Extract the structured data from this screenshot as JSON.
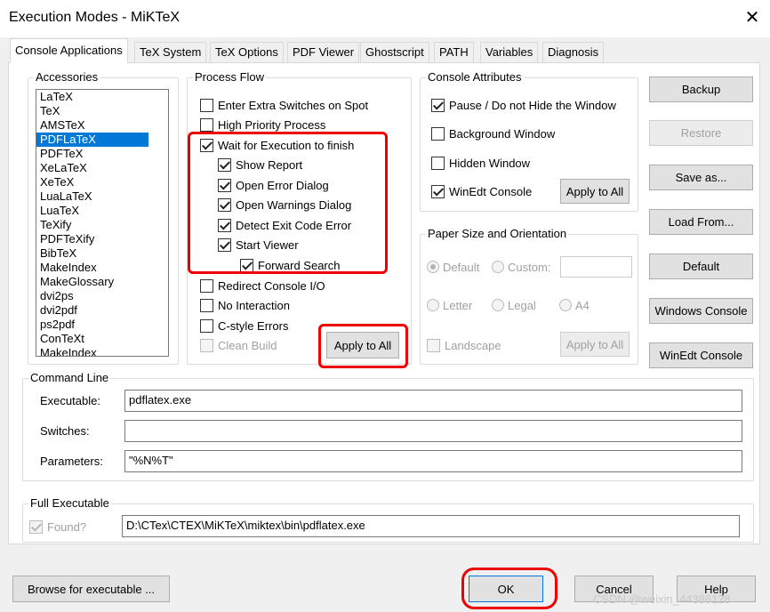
{
  "window": {
    "title": "Execution Modes - MiKTeX",
    "close": "✕"
  },
  "tabs": [
    "Console Applications",
    "TeX System",
    "TeX Options",
    "PDF Viewer",
    "Ghostscript",
    "PATH",
    "Variables",
    "Diagnosis"
  ],
  "accessories": {
    "title": "Accessories",
    "items": [
      "LaTeX",
      "TeX",
      "AMSTeX",
      "PDFLaTeX",
      "PDFTeX",
      "XeLaTeX",
      "XeTeX",
      "LuaLaTeX",
      "LuaTeX",
      "TeXify",
      "PDFTeXify",
      "BibTeX",
      "MakeIndex",
      "MakeGlossary",
      "dvi2ps",
      "dvi2pdf",
      "ps2pdf",
      "ConTeXt",
      "MakeIndex"
    ],
    "selected": "PDFLaTeX",
    "scroll_up": "▲",
    "scroll_down": "▼"
  },
  "process_flow": {
    "title": "Process Flow",
    "options": {
      "extra_switches": "Enter Extra Switches on Spot",
      "high_priority": "High Priority Process",
      "wait_for_execution": "Wait for Execution to finish",
      "show_report": "Show Report",
      "open_error_dialog": "Open Error Dialog",
      "open_warnings_dialog": "Open Warnings Dialog",
      "detect_exit_code": "Detect Exit Code Error",
      "start_viewer": "Start Viewer",
      "forward_search": "Forward Search",
      "redirect_console": "Redirect Console I/O",
      "no_interaction": "No Interaction",
      "c_style_errors": "C-style Errors",
      "clean_build": "Clean Build"
    },
    "apply_to_all": "Apply to All"
  },
  "console_attributes": {
    "title": "Console Attributes",
    "pause": "Pause / Do not Hide the Window",
    "background": "Background Window",
    "hidden": "Hidden Window",
    "winedt_console": "WinEdt Console",
    "apply_to_all": "Apply to All"
  },
  "paper": {
    "title": "Paper Size and Orientation",
    "default": "Default",
    "custom": "Custom:",
    "custom_value": "",
    "letter": "Letter",
    "legal": "Legal",
    "a4": "A4",
    "landscape": "Landscape",
    "apply_to_all": "Apply to All"
  },
  "side_buttons": {
    "backup": "Backup",
    "restore": "Restore",
    "save_as": "Save as...",
    "load_from": "Load From...",
    "default": "Default",
    "windows_console": "Windows Console",
    "winedt_console": "WinEdt Console"
  },
  "command_line": {
    "title": "Command Line",
    "executable_label": "Executable:",
    "executable_value": "pdflatex.exe",
    "switches_label": "Switches:",
    "switches_value": "",
    "parameters_label": "Parameters:",
    "parameters_value": "\"%N%T\""
  },
  "full_executable": {
    "title": "Full Executable",
    "found_label": "Found?",
    "path": "D:\\CTex\\CTEX\\MiKTeX\\miktex\\bin\\pdflatex.exe"
  },
  "footer": {
    "browse": "Browse for executable ...",
    "ok": "OK",
    "cancel": "Cancel",
    "help": "Help",
    "watermark": "CSDN @weixin_44386128"
  },
  "colors": {
    "selection": "#0078d7",
    "annotation": "#e00000"
  }
}
